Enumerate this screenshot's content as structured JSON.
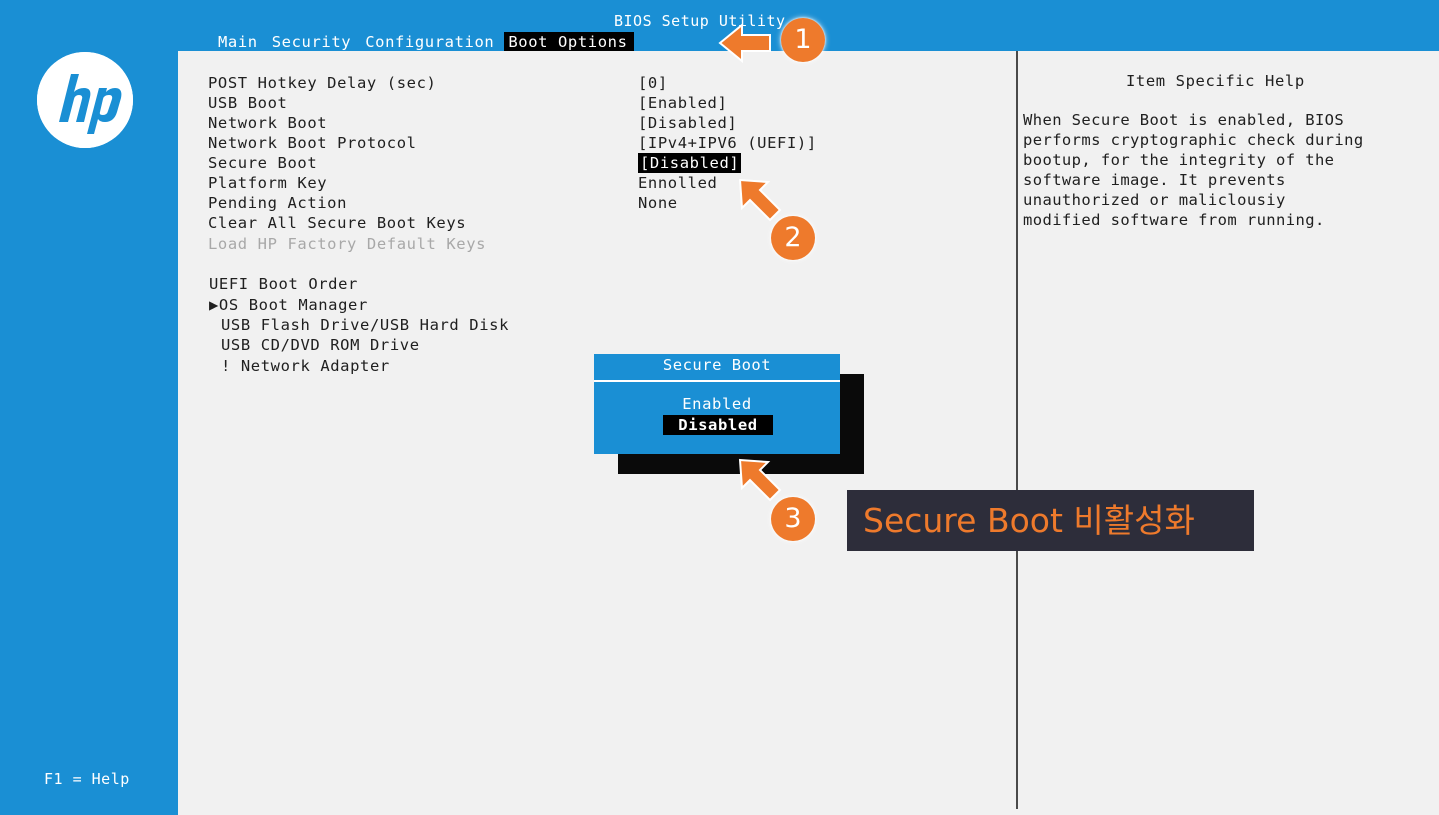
{
  "bios": {
    "title": "BIOS Setup Utility",
    "tabs": [
      {
        "label": "Main"
      },
      {
        "label": "Security"
      },
      {
        "label": "Configuration"
      },
      {
        "label": "Boot Options"
      }
    ],
    "active_tab": "Boot Options",
    "settings": [
      {
        "label": "POST Hotkey Delay (sec)",
        "value": "[0]"
      },
      {
        "label": "USB Boot",
        "value": "[Enabled]"
      },
      {
        "label": "Network Boot",
        "value": "[Disabled]"
      },
      {
        "label": "Network Boot Protocol",
        "value": "[IPv4+IPV6 (UEFI)]"
      },
      {
        "label": "Secure Boot",
        "value": "[Disabled]"
      },
      {
        "label": "Platform Key",
        "value": "Ennolled"
      },
      {
        "label": "Pending Action",
        "value": "None"
      },
      {
        "label": "Clear All Secure Boot Keys",
        "value": ""
      },
      {
        "label": "Load HP Factory Default Keys",
        "value": ""
      }
    ],
    "boot_order": {
      "heading": "UEFI Boot Order",
      "items": [
        "▶OS Boot Manager",
        "USB Flash Drive/USB Hard Disk",
        "USB CD/DVD ROM Drive",
        "! Network Adapter"
      ]
    },
    "help_panel": {
      "title": "Item Specific Help",
      "lines": [
        "When Secure Boot is enabled, BIOS",
        "performs cryptographic check during",
        "bootup, for the integrity of the",
        "software image. It prevents",
        "unauthorized or maliclousiy",
        "modified software from running."
      ]
    },
    "popup": {
      "title": "Secure Boot",
      "options": [
        "Enabled",
        "Disabled"
      ],
      "selected": "Disabled"
    },
    "f1_help": "F1 = Help"
  },
  "annotations": {
    "badges": [
      "1",
      "2",
      "3"
    ],
    "callout_text": "Secure Boot 비활성화",
    "accent_color": "#ee7a2c"
  },
  "colors": {
    "bios_blue": "#1a8fd4",
    "panel_gray": "#f1f1f1",
    "highlight_black": "#000000"
  },
  "icons": {
    "logo": "hp-logo-icon",
    "arrows": "orange-arrow-icon"
  }
}
